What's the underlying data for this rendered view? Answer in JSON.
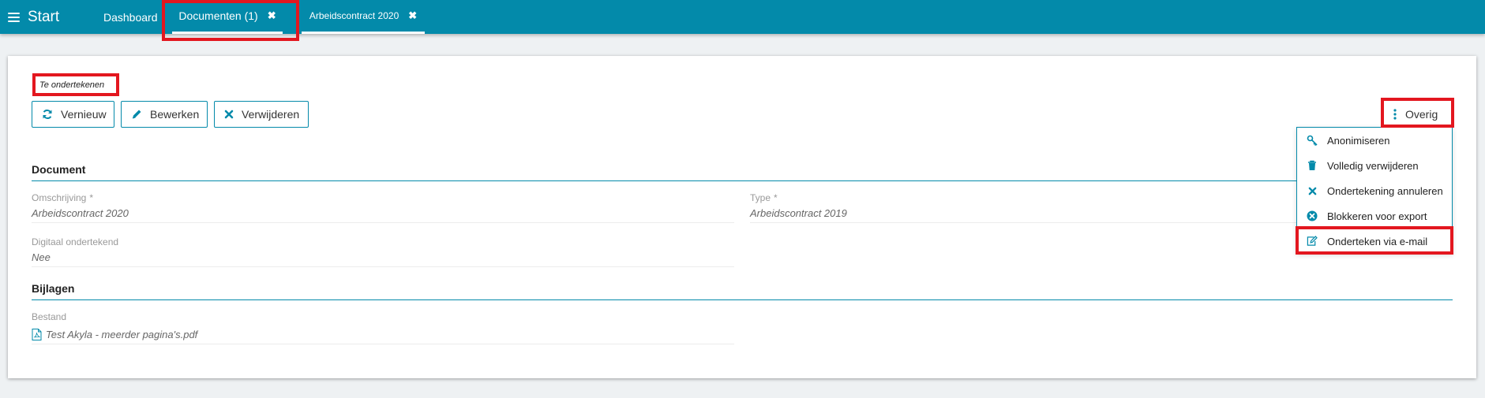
{
  "topbar": {
    "start_label": "Start",
    "tabs": [
      {
        "label": "Dashboard"
      },
      {
        "label": "Documenten (1)",
        "close": "✖"
      },
      {
        "label": "Arbeidscontract 2020",
        "close": "✖"
      }
    ]
  },
  "status": "Te ondertekenen",
  "toolbar": {
    "vernieuw": "Vernieuw",
    "bewerken": "Bewerken",
    "verwijderen": "Verwijderen",
    "overig": "Overig"
  },
  "document": {
    "section_title": "Document",
    "omschrijving_label": "Omschrijving",
    "omschrijving_value": "Arbeidscontract 2020",
    "type_label": "Type",
    "type_value": "Arbeidscontract 2019",
    "digitaal_label": "Digitaal ondertekend",
    "digitaal_value": "Nee",
    "required_mark": "*"
  },
  "bijlagen": {
    "section_title": "Bijlagen",
    "bestand_label": "Bestand",
    "bestand_value": "Test Akyla - meerder pagina's.pdf"
  },
  "overig_menu": {
    "items": [
      {
        "label": "Anonimiseren",
        "icon": "key-icon"
      },
      {
        "label": "Volledig verwijderen",
        "icon": "trash-icon"
      },
      {
        "label": "Ondertekening annuleren",
        "icon": "times-icon"
      },
      {
        "label": "Blokkeren voor export",
        "icon": "times-circle-icon"
      },
      {
        "label": "Onderteken via e-mail",
        "icon": "edit-icon"
      }
    ]
  },
  "colors": {
    "accent": "#038aaa",
    "highlight": "#e3171f"
  }
}
